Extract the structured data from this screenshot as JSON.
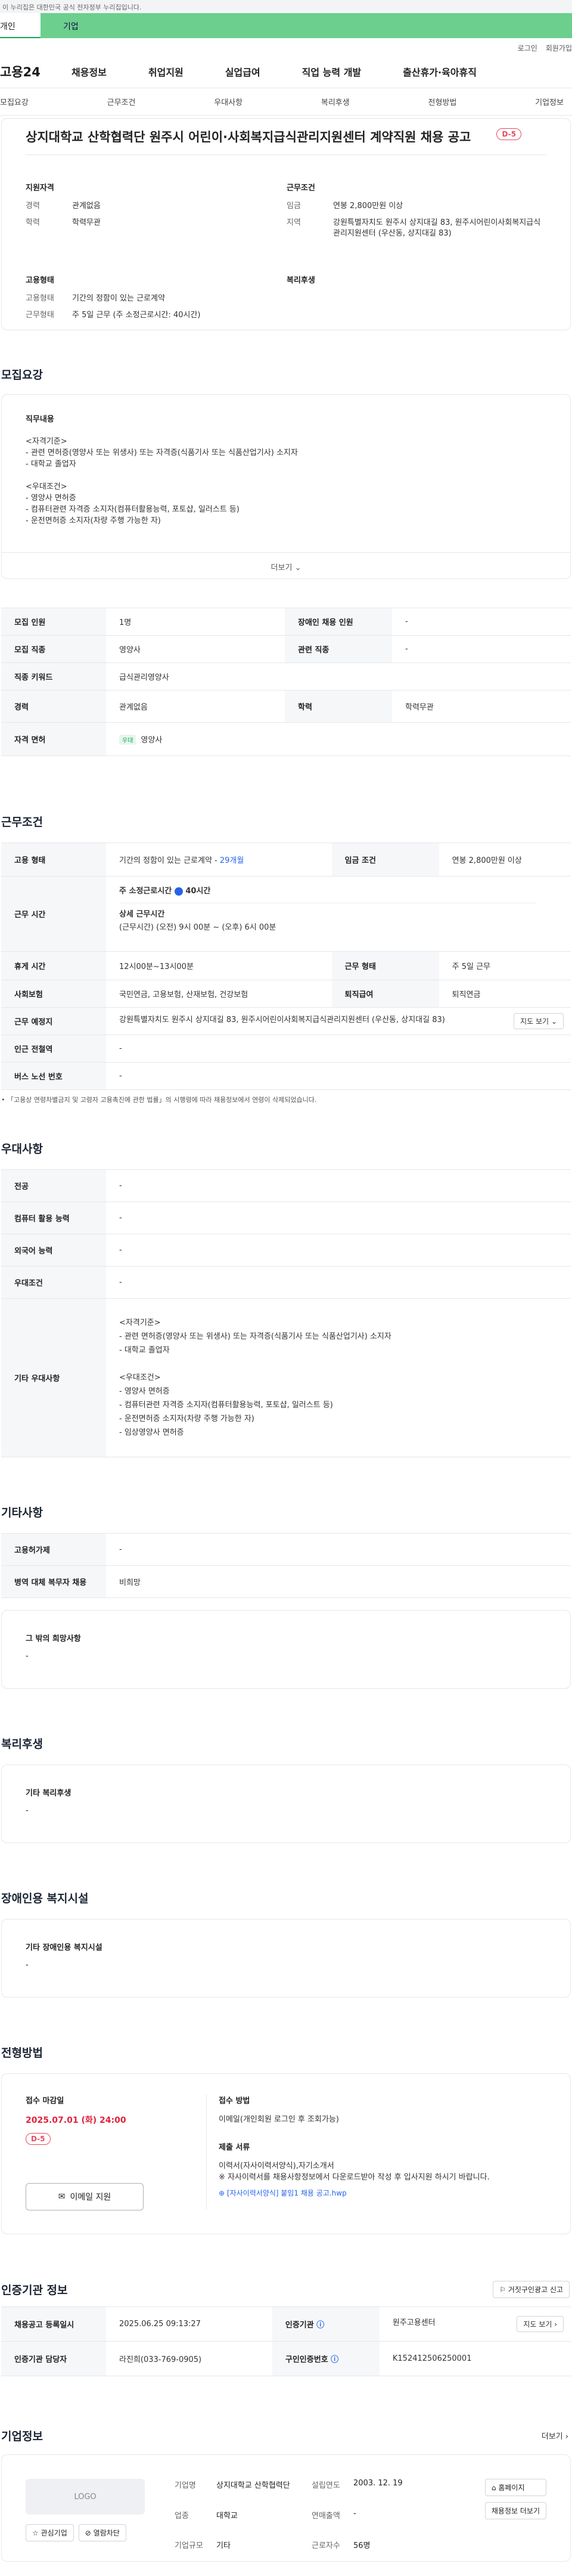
{
  "gov_banner": "이 누리집은 대한민국 공식 전자정부 누리집입니다.",
  "top_tabs": {
    "personal": "개인",
    "corporate": "기업"
  },
  "util": {
    "login": "로그인",
    "signup": "회원가입"
  },
  "gnb": {
    "logo": "고용24",
    "items": [
      "채용정보",
      "취업지원",
      "실업급여",
      "직업 능력 개발",
      "출산휴가·육아휴직"
    ]
  },
  "subnav": [
    "모집요강",
    "근무조건",
    "우대사항",
    "복리후생",
    "전형방법",
    "기업정보"
  ],
  "job": {
    "title": "상지대학교 산학협력단 원주시 어린이·사회복지급식관리지원센터 계약직원 채용 공고",
    "dday": "D-5",
    "qual_title": "지원자격",
    "qual": [
      {
        "k": "경력",
        "v": "관계없음"
      },
      {
        "k": "학력",
        "v": "학력무관"
      }
    ],
    "cond_title": "근무조건",
    "cond": [
      {
        "k": "임금",
        "v": "연봉 2,800만원 이상"
      },
      {
        "k": "지역",
        "v": "강원특별자치도 원주시 상지대길 83, 원주시어린이사회복지급식관리지원센터 (우산동, 상지대길 83)"
      }
    ],
    "emp_title": "고용형태",
    "emp": [
      {
        "k": "고용형태",
        "v": "기간의 정함이 있는 근로계약"
      },
      {
        "k": "근무형태",
        "v": "주 5일 근무 (주 소정근로시간: 40시간)"
      }
    ],
    "welfare_title": "복리후생"
  },
  "recruit": {
    "section_title": "모집요강",
    "box_title": "직무내용",
    "body": "<자격기준>\n- 관련 면허증(영양사 또는 위생사) 또는 자격증(식품기사 또는 식품산업기사) 소지자\n- 대학교 졸업자\n\n<우대조건>\n- 영양사 면허증\n- 컴퓨터관련 자격증 소지자(컴퓨터활용능력, 포토샵, 일러스트 등)\n- 운전면허증 소지자(차량 주행 가능한 자)",
    "more": "더보기"
  },
  "recruit_table": {
    "rows": [
      {
        "k1": "모집 인원",
        "v1": "1명",
        "k2": "장애인 채용 인원",
        "v2": "-"
      },
      {
        "k1": "모집 직종",
        "v1": "영양사",
        "k2": "관련 직종",
        "v2": "-"
      },
      {
        "k1": "직종 키워드",
        "v1": "급식관리영양사"
      },
      {
        "k1": "경력",
        "v1": "관계없음",
        "k2": "학력",
        "v2": "학력무관"
      }
    ],
    "license_k": "자격 면허",
    "license_tag": "우대",
    "license_v": "영양사"
  },
  "work": {
    "section_title": "근무조건",
    "emp_k": "고용 형태",
    "emp_v": "기간의 정함이 있는 근로계약 -",
    "emp_months": "29개월",
    "wage_k": "임금 조건",
    "wage_v": "연봉 2,800만원 이상",
    "time_k": "근무 시간",
    "time_weekly": "주 소정근로시간",
    "time_weekly_hours": "40시간",
    "time_detail_title": "상세 근무시간",
    "time_detail": "(근무시간) (오전) 9시 00분 ~ (오후) 6시 00분",
    "rest_k": "휴게 시간",
    "rest_v": "12시00분~13시00분",
    "form_k": "근무 형태",
    "form_v": "주 5일 근무",
    "ins_k": "사회보험",
    "ins_v": "국민연금, 고용보험, 산재보험, 건강보험",
    "retire_k": "퇴직급여",
    "retire_v": "퇴직연금",
    "place_k": "근무 예정지",
    "place_v": "강원특별자치도 원주시 상지대길 83, 원주시어린이사회복지급식관리지원센터 (우산동, 상지대길 83)",
    "map_btn": "지도 보기",
    "subway_k": "인근 전철역",
    "subway_v": "-",
    "bus_k": "버스 노선 번호",
    "bus_v": "-",
    "note": "「고용상 연령차별금지 및 고령자 고용촉진에 관한 법률」의 시행령에 따라 채용정보에서 연령이 삭제되었습니다."
  },
  "pref": {
    "section_title": "우대사항",
    "rows": [
      {
        "k": "전공",
        "v": "-"
      },
      {
        "k": "컴퓨터 활용 능력",
        "v": "-"
      },
      {
        "k": "외국어 능력",
        "v": "-"
      },
      {
        "k": "우대조건",
        "v": "-"
      }
    ],
    "etc_k": "기타 우대사항",
    "etc_v": "<자격기준>\n- 관련 면허증(영양사 또는 위생사) 또는 자격증(식품기사 또는 식품산업기사) 소지자\n- 대학교 졸업자\n\n<우대조건>\n- 영양사 면허증\n- 컴퓨터관련 자격증 소지자(컴퓨터활용능력, 포토샵, 일러스트 등)\n- 운전면허증 소지자(차량 주행 가능한 자)\n- 임상영양사 면허증"
  },
  "other": {
    "section_title": "기타사항",
    "rows": [
      {
        "k": "고용허가제",
        "v": "-"
      },
      {
        "k": "병역 대체 복무자 채용",
        "v": "비희망"
      }
    ],
    "etc_title": "그 밖의 희망사항",
    "etc_v": "-"
  },
  "welfare": {
    "section_title": "복리후생",
    "box_title": "기타 복리후생",
    "v": "-"
  },
  "disabled": {
    "section_title": "장애인용 복지시설",
    "box_title": "기타 장애인용 복지시설",
    "v": "-"
  },
  "process": {
    "section_title": "전형방법",
    "deadline_title": "접수 마감일",
    "deadline": "2025.07.01 (화) 24:00",
    "dday": "D-5",
    "email_btn": "이메일 지원",
    "method_title": "접수 방법",
    "method": "이메일(개인회원 로그인 후 조회가능)",
    "docs_title": "제출 서류",
    "docs": "이력서(자사이력서양식),자기소개서\n※ 자사이력서를 채용사항정보에서 다운로드받아 작성 후 입사지원 하시기 바랍니다.",
    "attach": "[자사이력서양식] 붙임1 채용 공고.hwp"
  },
  "agency": {
    "section_title": "인증기관 정보",
    "report_btn": "거짓구인광고 신고",
    "reg_k": "채용공고 등록일시",
    "reg_v": "2025.06.25 09:13:27",
    "org_k": "인증기관",
    "org_v": "원주고용센터",
    "map_btn": "지도 보기",
    "staff_k": "인증기관 담당자",
    "staff_v": "라진희(033-769-0905)",
    "num_k": "구인인증번호",
    "num_v": "K152412506250001"
  },
  "company": {
    "section_title": "기업정보",
    "more": "더보기",
    "logo": "LOGO",
    "fav_btn": "관심기업",
    "block_btn": "열람차단",
    "name_k": "기업명",
    "name_v": "상지대학교 산학협력단",
    "industry_k": "업종",
    "industry_v": "대학교",
    "scale_k": "기업규모",
    "scale_v": "기타",
    "est_k": "설립연도",
    "est_v": "2003. 12. 19",
    "sales_k": "연매출액",
    "sales_v": "-",
    "emp_k": "근로자수",
    "emp_v": "56명",
    "home_btn": "홈페이지",
    "jobs_btn": "채용정보 더보기"
  }
}
